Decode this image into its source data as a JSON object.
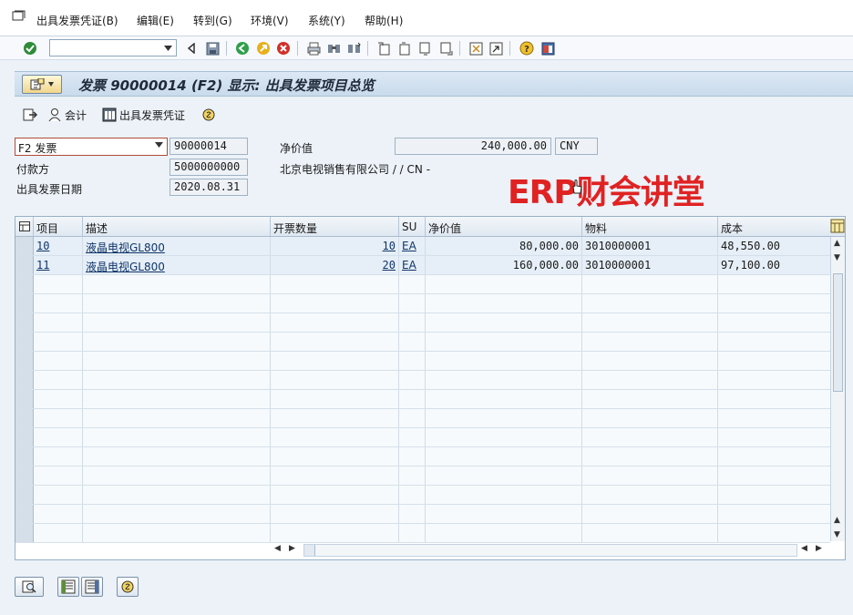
{
  "menu": {
    "items": [
      "出具发票凭证(B)",
      "编辑(E)",
      "转到(G)",
      "环境(V)",
      "系统(Y)",
      "帮助(H)"
    ]
  },
  "toolbar": {
    "command_value": "",
    "icons": [
      "enter-icon",
      "back-icon",
      "save-icon",
      "green-back-icon",
      "exit-icon",
      "cancel-icon",
      "print-icon",
      "find-icon",
      "find-next-icon",
      "first-page-icon",
      "prev-page-icon",
      "next-page-icon",
      "last-page-icon",
      "new-session-icon",
      "shortcut-icon",
      "help-icon",
      "customize-icon"
    ]
  },
  "title": {
    "text": "发票 90000014  (F2) 显示: 出具发票项目总览"
  },
  "app_toolbar": {
    "accounting_label": "会计",
    "billing_doc_label": "出具发票凭证"
  },
  "header": {
    "billing_type": "F2 发票",
    "billing_number": "90000014",
    "net_value_label": "净价值",
    "net_value": "240,000.00",
    "currency": "CNY",
    "payer_label": "付款方",
    "payer_number": "5000000000",
    "payer_name": "北京电视销售有限公司 / / CN -",
    "billing_date_label": "出具发票日期",
    "billing_date": "2020.08.31"
  },
  "watermark": "ERP财会讲堂",
  "table": {
    "columns": [
      "项目",
      "描述",
      "开票数量",
      "SU",
      "净价值",
      "物料",
      "成本"
    ],
    "rows": [
      {
        "item": "10",
        "desc": "液晶电视GL800",
        "qty": "10",
        "su": "EA",
        "net": "80,000.00",
        "material": "3010000001",
        "cost": "48,550.00"
      },
      {
        "item": "11",
        "desc": "液晶电视GL800",
        "qty": "20",
        "su": "EA",
        "net": "160,000.00",
        "material": "3010000001",
        "cost": "97,100.00"
      }
    ]
  },
  "colors": {
    "background": "#ecf2f8",
    "watermark": "#e02222",
    "title_bar": "#c9dbec"
  }
}
